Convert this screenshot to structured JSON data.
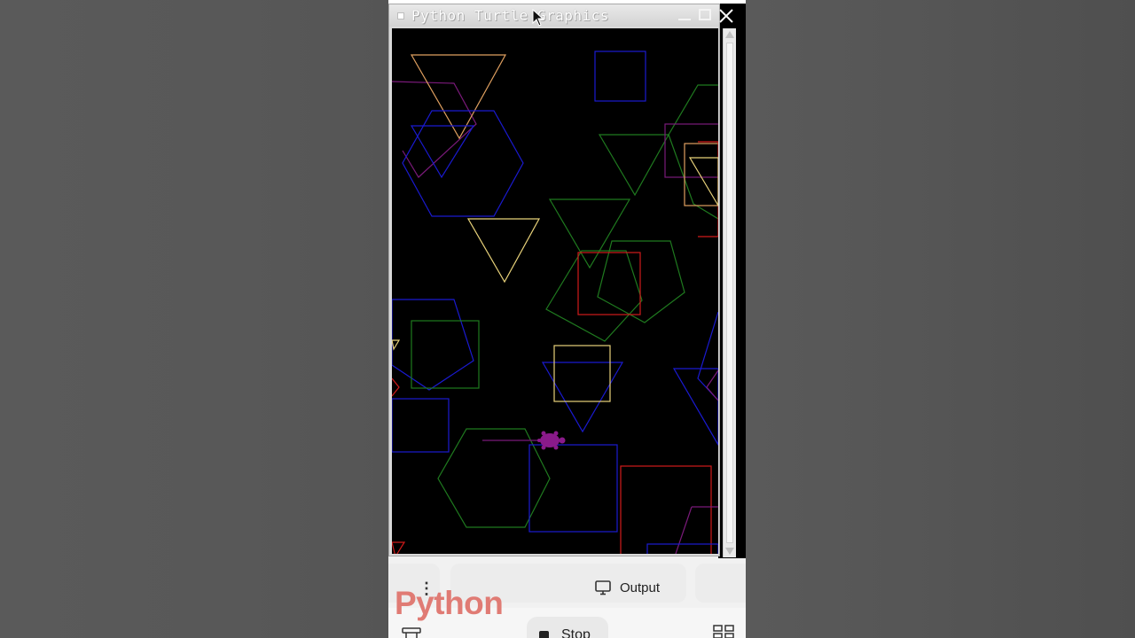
{
  "window": {
    "title": "Python Turtle Graphics"
  },
  "tabs": {
    "output_label": "Output"
  },
  "watermark": {
    "text": "Python"
  },
  "controls": {
    "stop_label": "Stop"
  },
  "colors": {
    "canvas_bg": "#000000",
    "blue": "#1a1ad0",
    "green": "#1f7a1f",
    "red": "#d01a1a",
    "yellow": "#e8d27a",
    "orange": "#e0a060",
    "purple": "#7a1a7a",
    "turtle": "#8a1a8a",
    "logo": "#e07b74"
  },
  "icons": [
    "monitor-icon",
    "kebab-menu-icon",
    "stop-icon",
    "layout-icon",
    "grid-icon",
    "mouse-cursor-icon",
    "turtle-icon"
  ]
}
